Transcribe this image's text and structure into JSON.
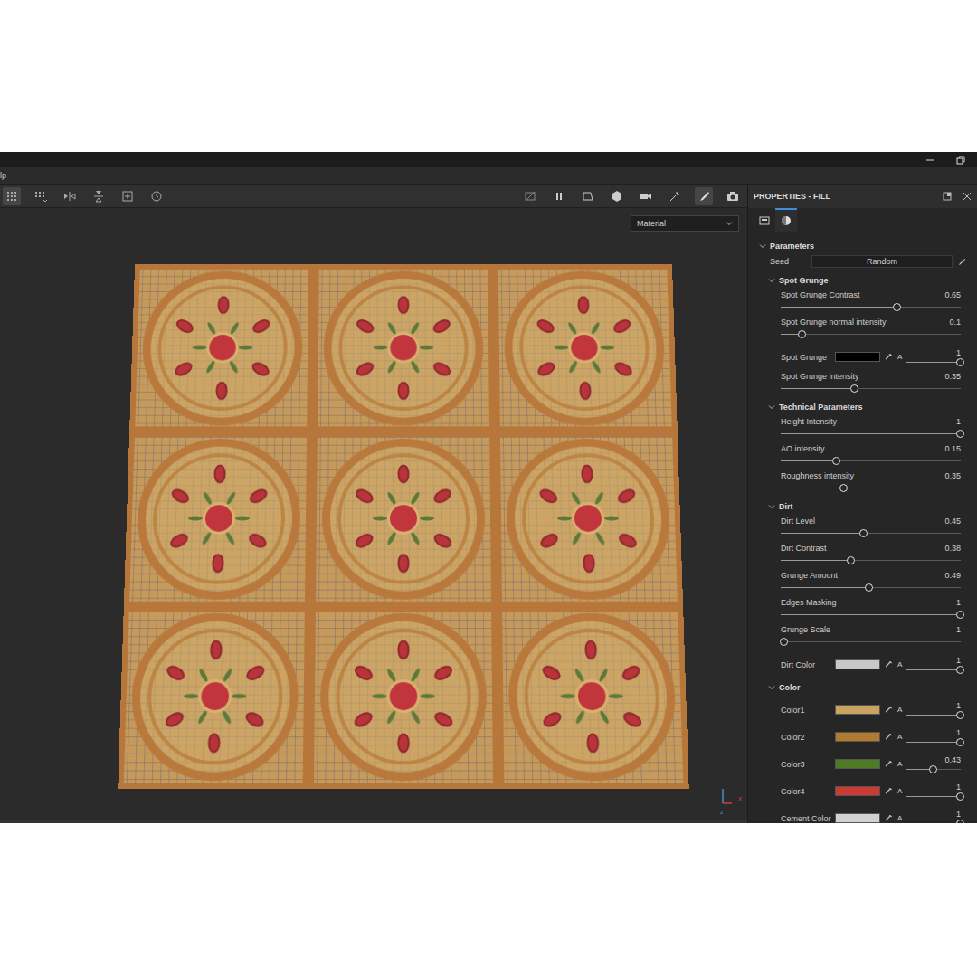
{
  "window": {
    "menu": [
      "lp"
    ]
  },
  "viewport": {
    "dropdown": "Material",
    "axes": [
      "x",
      "z"
    ]
  },
  "properties": {
    "title": "PROPERTIES - FILL",
    "tabs": [
      {
        "selected": false
      },
      {
        "selected": true
      }
    ],
    "section": {
      "title": "Parameters",
      "expanded": true
    },
    "seed": {
      "label": "Seed",
      "value": "Random"
    },
    "groups": [
      {
        "title": "Spot Grunge",
        "expanded": true,
        "rows": [
          {
            "kind": "slider",
            "label": "Spot Grunge Contrast",
            "value": "0.65",
            "level": 0.65
          },
          {
            "kind": "slider",
            "label": "Spot Grunge normal intensity",
            "value": "0.1",
            "level": 0.12
          },
          {
            "kind": "color",
            "label": "Spot Grunge",
            "swatch": "#000000",
            "alpha": "A",
            "value": "1",
            "level": 1
          },
          {
            "kind": "slider",
            "label": "Spot Grunge intensity",
            "value": "0.35",
            "level": 0.41
          }
        ]
      },
      {
        "title": "Technical Parameters",
        "expanded": true,
        "rows": [
          {
            "kind": "slider",
            "label": "Height Intensity",
            "value": "1",
            "level": 1
          },
          {
            "kind": "slider",
            "label": "AO intensity",
            "value": "0.15",
            "level": 0.31
          },
          {
            "kind": "slider",
            "label": "Roughness intensity",
            "value": "0.35",
            "level": 0.35
          }
        ]
      },
      {
        "title": "Dirt",
        "expanded": true,
        "rows": [
          {
            "kind": "slider",
            "label": "Dirt Level",
            "value": "0.45",
            "level": 0.46
          },
          {
            "kind": "slider",
            "label": "Dirt Contrast",
            "value": "0.38",
            "level": 0.39
          },
          {
            "kind": "slider",
            "label": "Grunge Amount",
            "value": "0.49",
            "level": 0.49
          },
          {
            "kind": "slider",
            "label": "Edges Masking",
            "value": "1",
            "level": 1
          },
          {
            "kind": "slider",
            "label": "Grunge Scale",
            "value": "1",
            "level": 0.02
          },
          {
            "kind": "color",
            "label": "Dirt Color",
            "swatch": "#c8c8c8",
            "alpha": "A",
            "value": "1",
            "level": 1
          }
        ]
      },
      {
        "title": "Color",
        "expanded": true,
        "rows": [
          {
            "kind": "color",
            "label": "Color1",
            "swatch": "#c9a35f",
            "alpha": "A",
            "value": "1",
            "level": 1
          },
          {
            "kind": "color",
            "label": "Color2",
            "swatch": "#b27a2c",
            "alpha": "A",
            "value": "1",
            "level": 1
          },
          {
            "kind": "color",
            "label": "Color3",
            "swatch": "#4f7a25",
            "alpha": "A",
            "value": "0.43",
            "level": 0.5
          },
          {
            "kind": "color",
            "label": "Color4",
            "swatch": "#cc3a33",
            "alpha": "A",
            "value": "1",
            "level": 1
          },
          {
            "kind": "color",
            "label": "Cement Color",
            "swatch": "#d2d2d2",
            "alpha": "A",
            "value": "1",
            "level": 1
          }
        ]
      }
    ]
  }
}
